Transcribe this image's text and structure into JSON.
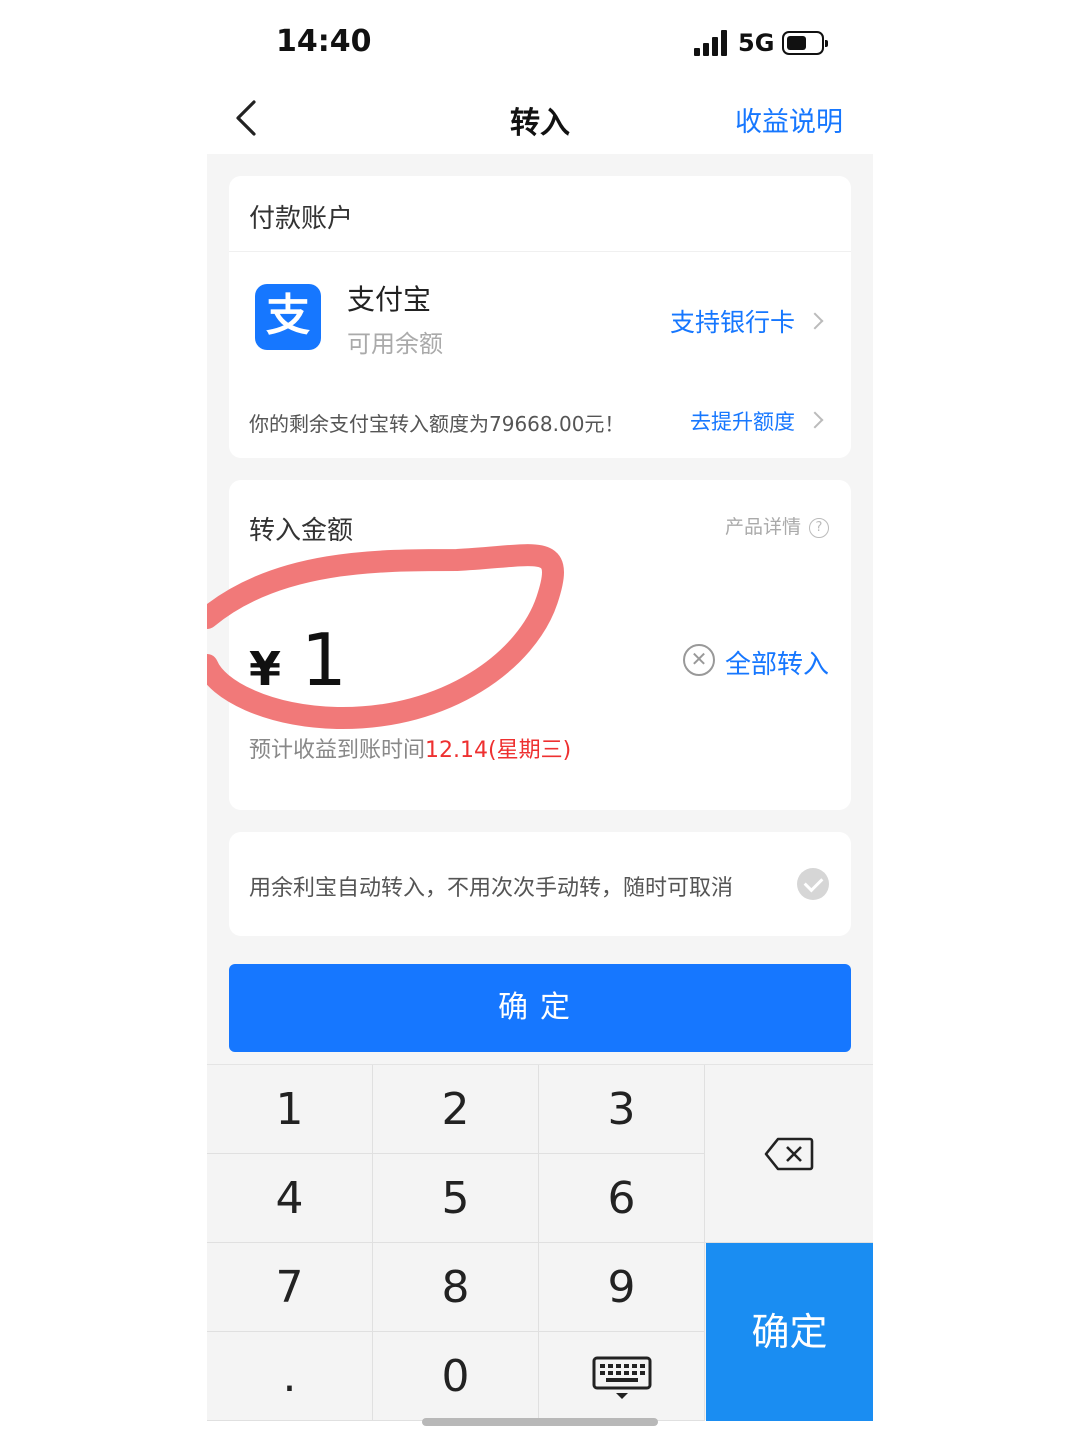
{
  "status_bar": {
    "time": "14:40",
    "network": "5G"
  },
  "nav": {
    "title": "转入",
    "right_link": "收益说明"
  },
  "payment_account": {
    "header": "付款账户",
    "account_name": "支付宝",
    "balance_label": "可用余额",
    "bank_link": "支持银行卡",
    "quota_text": "你的剩余支付宝转入额度为79668.00元！",
    "quota_link": "去提升额度"
  },
  "transfer_amount": {
    "header": "转入金额",
    "product_detail": "产品详情",
    "currency": "¥",
    "amount": "1",
    "all_in_label": "全部转入",
    "eta_label": "预计收益到账时间",
    "eta_date": "12.14(星期三)"
  },
  "auto_transfer": {
    "text": "用余利宝自动转入，不用次次手动转，随时可取消"
  },
  "confirm_button": "确定",
  "keypad": {
    "keys": [
      "1",
      "2",
      "3",
      "4",
      "5",
      "6",
      "7",
      "8",
      "9",
      ".",
      "0"
    ],
    "ok_label": "确定"
  },
  "colors": {
    "accent": "#1677ff",
    "highlight": "#ee3030",
    "annotation": "#f06e6e"
  }
}
